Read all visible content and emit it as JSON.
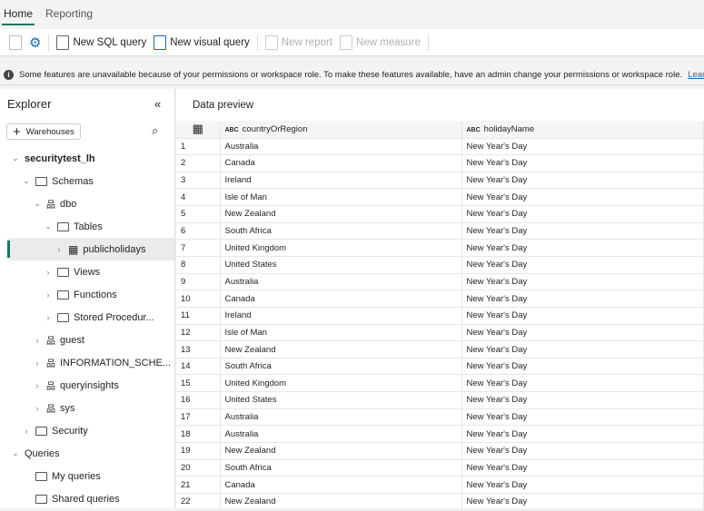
{
  "tabs": [
    "Home",
    "Reporting"
  ],
  "toolbar": {
    "new_sql": "New SQL query",
    "new_visual": "New visual query",
    "new_report": "New report",
    "new_measure": "New measure"
  },
  "banner": {
    "text": "Some features are unavailable because of your permissions or workspace role. To make these features available, have an admin change your permissions or workspace role.",
    "link": "Learn more"
  },
  "explorer": {
    "title": "Explorer",
    "warehouses": "Warehouses",
    "tree": [
      {
        "label": "securitytest_lh",
        "level": 0,
        "chev": "v",
        "icon": "none",
        "bold": true
      },
      {
        "label": "Schemas",
        "level": 1,
        "chev": "v",
        "icon": "folder"
      },
      {
        "label": "dbo",
        "level": 2,
        "chev": "v",
        "icon": "schema"
      },
      {
        "label": "Tables",
        "level": 3,
        "chev": "v",
        "icon": "folder"
      },
      {
        "label": "publicholidays",
        "level": 4,
        "chev": ">",
        "icon": "table",
        "selected": true
      },
      {
        "label": "Views",
        "level": 3,
        "chev": ">",
        "icon": "folder"
      },
      {
        "label": "Functions",
        "level": 3,
        "chev": ">",
        "icon": "folder"
      },
      {
        "label": "Stored Procedur...",
        "level": 3,
        "chev": ">",
        "icon": "folder"
      },
      {
        "label": "guest",
        "level": 2,
        "chev": ">",
        "icon": "schema"
      },
      {
        "label": "INFORMATION_SCHE...",
        "level": 2,
        "chev": ">",
        "icon": "schema"
      },
      {
        "label": "queryinsights",
        "level": 2,
        "chev": ">",
        "icon": "schema"
      },
      {
        "label": "sys",
        "level": 2,
        "chev": ">",
        "icon": "schema"
      },
      {
        "label": "Security",
        "level": 1,
        "chev": ">",
        "icon": "folder"
      },
      {
        "label": "Queries",
        "level": 0,
        "chev": "v",
        "icon": "none"
      },
      {
        "label": "My queries",
        "level": 1,
        "chev": "",
        "icon": "folder"
      },
      {
        "label": "Shared queries",
        "level": 1,
        "chev": "",
        "icon": "folder"
      }
    ]
  },
  "preview": {
    "title": "Data preview",
    "type_label": "ABC",
    "columns": [
      "countryOrRegion",
      "holidayName"
    ],
    "rows": [
      [
        "Australia",
        "New Year's Day"
      ],
      [
        "Canada",
        "New Year's Day"
      ],
      [
        "Ireland",
        "New Year's Day"
      ],
      [
        "Isle of Man",
        "New Year's Day"
      ],
      [
        "New Zealand",
        "New Year's Day"
      ],
      [
        "South Africa",
        "New Year's Day"
      ],
      [
        "United Kingdom",
        "New Year's Day"
      ],
      [
        "United States",
        "New Year's Day"
      ],
      [
        "Australia",
        "New Year's Day"
      ],
      [
        "Canada",
        "New Year's Day"
      ],
      [
        "Ireland",
        "New Year's Day"
      ],
      [
        "Isle of Man",
        "New Year's Day"
      ],
      [
        "New Zealand",
        "New Year's Day"
      ],
      [
        "South Africa",
        "New Year's Day"
      ],
      [
        "United Kingdom",
        "New Year's Day"
      ],
      [
        "United States",
        "New Year's Day"
      ],
      [
        "Australia",
        "New Year's Day"
      ],
      [
        "Australia",
        "New Year's Day"
      ],
      [
        "New Zealand",
        "New Year's Day"
      ],
      [
        "South Africa",
        "New Year's Day"
      ],
      [
        "Canada",
        "New Year's Day"
      ],
      [
        "New Zealand",
        "New Year's Day"
      ]
    ]
  }
}
